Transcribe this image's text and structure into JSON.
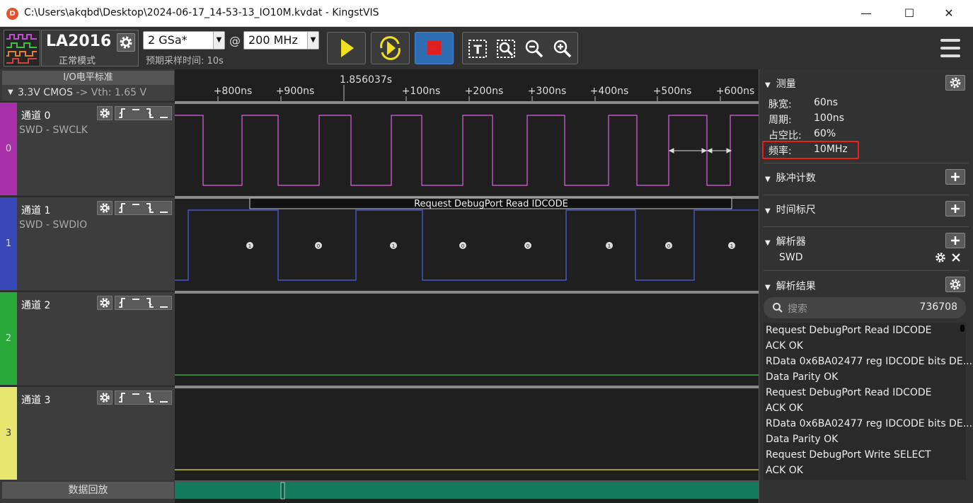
{
  "window": {
    "title": "C:\\Users\\akqbd\\Desktop\\2024-06-17_14-53-13_IO10M.kvdat - KingstVIS",
    "minimize": "—",
    "maximize": "☐",
    "close": "✕"
  },
  "device": {
    "name": "LA2016",
    "mode": "正常模式"
  },
  "sampling": {
    "rate": "2 GSa*",
    "at": "@",
    "freq": "200 MHz",
    "expected_time": "预期采样时间: 10s"
  },
  "io_level": {
    "header": "I/O电平标准",
    "standard": "3.3V CMOS",
    "vth": "-> Vth: 1.65 V"
  },
  "channels": [
    {
      "name": "通道 0",
      "protocol": "SWD - SWCLK",
      "index": "0",
      "color": "#c040c0",
      "wave_color": "#e060e0"
    },
    {
      "name": "通道 1",
      "protocol": "SWD - SWDIO",
      "index": "1",
      "color": "#4050c8",
      "wave_color": "#5060e8"
    },
    {
      "name": "通道 2",
      "protocol": "",
      "index": "2",
      "color": "#30a040",
      "wave_color": "#40c840"
    },
    {
      "name": "通道 3",
      "protocol": "",
      "index": "3",
      "color": "#d8d860",
      "wave_color": "#e0e040"
    }
  ],
  "timeline": {
    "cursor_time": "1.856037s",
    "ticks": [
      "+800ns",
      "+900ns",
      "+100ns",
      "+200ns",
      "+300ns",
      "+400ns",
      "+500ns",
      "+600ns"
    ]
  },
  "decode": {
    "frame_label": "Request DebugPort Read IDCODE",
    "bits": [
      "1",
      "0",
      "1",
      "0",
      "0",
      "1",
      "0",
      "1"
    ]
  },
  "playback_label": "数据回放",
  "measure": {
    "title": "测量",
    "rows": [
      {
        "label": "脉宽:",
        "value": "60ns"
      },
      {
        "label": "周期:",
        "value": "100ns"
      },
      {
        "label": "占空比:",
        "value": "60%"
      },
      {
        "label": "频率:",
        "value": "10MHz"
      }
    ]
  },
  "pulse_count": {
    "title": "脉冲计数"
  },
  "time_ruler": {
    "title": "时间标尺"
  },
  "analyzer": {
    "title": "解析器",
    "item": "SWD"
  },
  "results": {
    "title": "解析结果",
    "search_placeholder": "搜索",
    "count": "736708",
    "items": [
      "Request DebugPort Read IDCODE",
      "ACK OK",
      "RData 0x6BA02477 reg IDCODE bits DE...",
      "Data Parity OK",
      "Request DebugPort Read IDCODE",
      "ACK OK",
      "RData 0x6BA02477 reg IDCODE bits DE...",
      "Data Parity OK",
      "Request DebugPort Write SELECT",
      "ACK OK"
    ]
  }
}
